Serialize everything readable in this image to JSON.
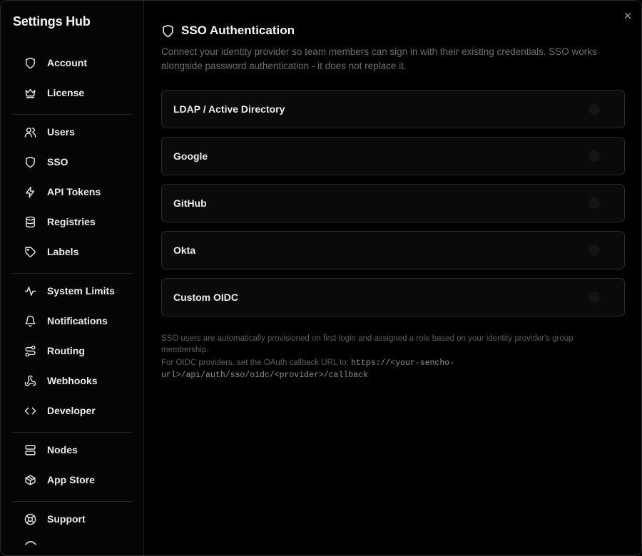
{
  "sidebar": {
    "title": "Settings Hub",
    "items": [
      {
        "label": "Account",
        "icon": "shield-icon"
      },
      {
        "label": "License",
        "icon": "crown-icon"
      },
      {
        "label": "Users",
        "icon": "users-icon"
      },
      {
        "label": "SSO",
        "icon": "shield-icon"
      },
      {
        "label": "API Tokens",
        "icon": "bolt-icon"
      },
      {
        "label": "Registries",
        "icon": "database-icon"
      },
      {
        "label": "Labels",
        "icon": "tag-icon"
      },
      {
        "label": "System Limits",
        "icon": "activity-icon"
      },
      {
        "label": "Notifications",
        "icon": "bell-icon"
      },
      {
        "label": "Routing",
        "icon": "route-icon"
      },
      {
        "label": "Webhooks",
        "icon": "webhook-icon"
      },
      {
        "label": "Developer",
        "icon": "code-icon"
      },
      {
        "label": "Nodes",
        "icon": "server-icon"
      },
      {
        "label": "App Store",
        "icon": "package-icon"
      },
      {
        "label": "Support",
        "icon": "lifebuoy-icon"
      }
    ]
  },
  "main": {
    "title": "SSO Authentication",
    "description": "Connect your identity provider so team members can sign in with their existing credentials. SSO works alongside password authentication - it does not replace it.",
    "providers": [
      {
        "name": "LDAP / Active Directory"
      },
      {
        "name": "Google"
      },
      {
        "name": "GitHub"
      },
      {
        "name": "Okta"
      },
      {
        "name": "Custom OIDC"
      }
    ],
    "footnote_1": "SSO users are automatically provisioned on first login and assigned a role based on your identity provider's group membership.",
    "footnote_2": "For OIDC providers, set the OAuth callback URL to: ",
    "callback_url": "https://<your-sencho-url>/api/auth/sso/oidc/<provider>/callback"
  },
  "colors": {
    "background": "#000000",
    "card": "#0a0a0a",
    "border": "#2a2a2a",
    "muted_text": "#6d6d6d"
  }
}
